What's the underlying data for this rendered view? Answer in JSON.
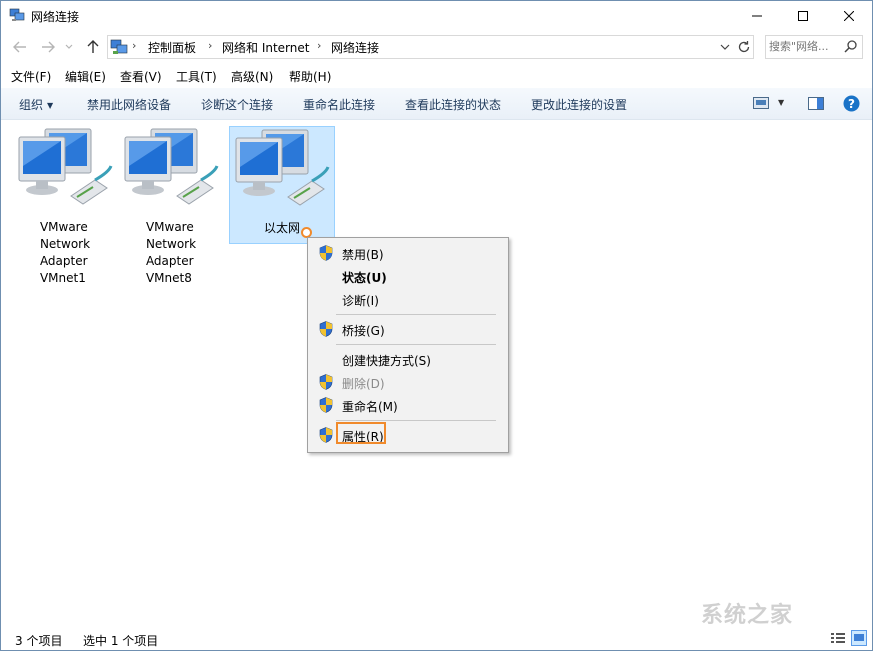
{
  "window": {
    "title": "网络连接",
    "icon": "network-folder-icon",
    "controls": [
      "minimize-icon",
      "maximize-icon",
      "close-icon"
    ]
  },
  "address_bar": {
    "breadcrumbs": [
      "控制面板",
      "网络和 Internet",
      "网络连接"
    ],
    "search_placeholder": "搜索\"网络..."
  },
  "menu": [
    "文件(F)",
    "编辑(E)",
    "查看(V)",
    "工具(T)",
    "高级(N)",
    "帮助(H)"
  ],
  "commands": [
    "组织",
    "禁用此网络设备",
    "诊断这个连接",
    "重命名此连接",
    "查看此连接的状态",
    "更改此连接的设置"
  ],
  "items": [
    {
      "label": "VMware Network Adapter VMnet1",
      "lines": [
        "VMware",
        "Network",
        "Adapter",
        "VMnet1"
      ],
      "selected": false
    },
    {
      "label": "VMware Network Adapter VMnet8",
      "lines": [
        "VMware",
        "Network",
        "Adapter",
        "VMnet8"
      ],
      "selected": false
    },
    {
      "label": "以太网",
      "lines": [
        "以太网"
      ],
      "selected": true
    }
  ],
  "context_menu": [
    {
      "label": "禁用(B)",
      "shield": true,
      "bold": false,
      "disabled": false
    },
    {
      "label": "状态(U)",
      "shield": false,
      "bold": true,
      "disabled": false
    },
    {
      "label": "诊断(I)",
      "shield": false,
      "bold": false,
      "disabled": false
    },
    {
      "label": "桥接(G)",
      "shield": true,
      "bold": false,
      "disabled": false
    },
    {
      "label": "创建快捷方式(S)",
      "shield": false,
      "bold": false,
      "disabled": false
    },
    {
      "label": "删除(D)",
      "shield": true,
      "bold": false,
      "disabled": true
    },
    {
      "label": "重命名(M)",
      "shield": true,
      "bold": false,
      "disabled": false
    },
    {
      "label": "属性(R)",
      "shield": true,
      "bold": false,
      "disabled": false,
      "highlighted": true
    }
  ],
  "status": {
    "item_count": "3 个项目",
    "selected_count": "选中 1 个项目"
  },
  "watermark": "系统之家",
  "colors": {
    "highlight": "#f08a2c",
    "selection_bg": "#cce8ff",
    "command_text": "#1e395b",
    "help_blue": "#1a73c7"
  }
}
